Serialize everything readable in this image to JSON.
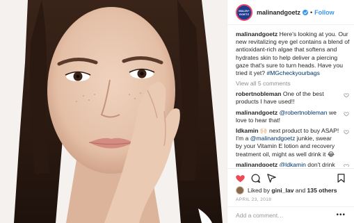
{
  "post": {
    "account": "malinandgoetz",
    "avatar_text": [
      "MALIN+",
      "GOETZ"
    ],
    "separator": "•",
    "follow_label": "Follow",
    "caption": {
      "user": "malinandgoetz",
      "text": "Here's looking at you. Our new revitalizing eye gel contains a blend of antioxidant-rich algae that softens and hydrates skin to help deliver a piercing gaze that's sure to turn heads. Have you tried it yet?",
      "hashtag": "#MGcheckyourbags"
    },
    "view_all_label": "View all 5 comments",
    "comments": [
      {
        "user": "robertnobleman",
        "text": "One of the best products I have used!!"
      },
      {
        "user": "malinandgoetz",
        "mention": "@robertnobleman",
        "text": " we love to hear that!"
      },
      {
        "user": "ldkamin",
        "text": "🙌🏻  next product to buy ASAP! I'm a ",
        "mention": "@malinandgoetz",
        "text2": " junkie, swear by your Vitamin E lotion and recovery treatment oil, might as well drink it 😂"
      },
      {
        "user": "malinandgoetz",
        "mention": "@ldkamin",
        "text": " don't drink it!!! But so glad you enjoy!"
      }
    ],
    "likes": {
      "prefix": "Liked by",
      "user": "gini_lav",
      "middle": "and",
      "count": "135 others"
    },
    "date": "APRIL 23, 2018",
    "add_comment_placeholder": "Add a comment…",
    "more_label": "•••",
    "icons": {
      "like": "heart-icon",
      "comment": "comment-bubble-icon",
      "share": "share-arrow-icon",
      "save": "bookmark-icon",
      "comment_like": "small-heart-icon",
      "verified": "verified-badge-icon"
    },
    "colors": {
      "like_red": "#ed4956",
      "link_blue": "#3897f0",
      "hashtag": "#003569",
      "muted": "#8e8e8e",
      "brand_navy": "#1f3b8f"
    }
  }
}
